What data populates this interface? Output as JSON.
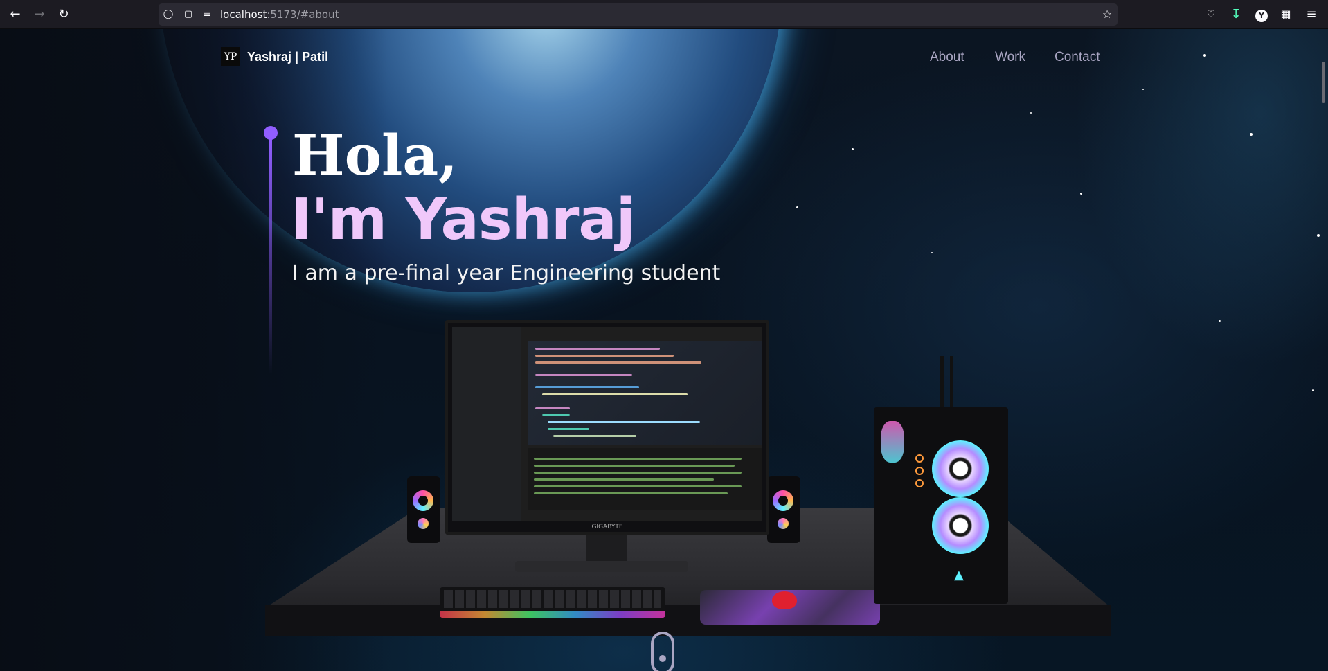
{
  "browser": {
    "url_host": "localhost",
    "url_rest": ":5173/#about",
    "icons": [
      "back-icon",
      "forward-icon",
      "reload-icon",
      "shield-icon",
      "page-icon",
      "permissions-icon",
      "star-icon",
      "pocket-icon",
      "download-icon",
      "profile-icon",
      "extensions-icon",
      "menu-icon"
    ],
    "profile_letter": "Y"
  },
  "navbar": {
    "logo_text": "YP",
    "brand": "Yashraj | Patil",
    "links": [
      "About",
      "Work",
      "Contact"
    ]
  },
  "hero": {
    "greeting": "Hola,",
    "name": "I'm Yashraj",
    "subtitle": "I am a pre-final year Engineering student",
    "accent_color": "#915eff",
    "name_color": "#f0c8fa"
  },
  "scene": {
    "monitor_brand": "GIGABYTE"
  }
}
